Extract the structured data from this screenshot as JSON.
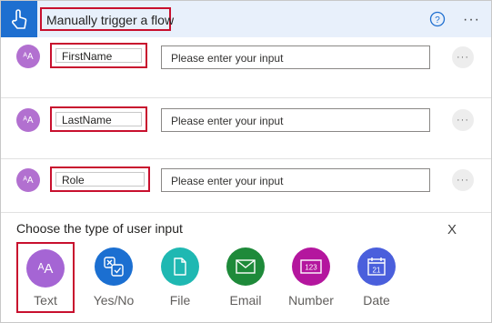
{
  "header": {
    "title": "Manually trigger a flow",
    "help_icon": "help-circle-icon",
    "more_label": "···"
  },
  "inputs": [
    {
      "avatar": "ᴬA",
      "name": "FirstName",
      "placeholder": "Please enter your input",
      "more": "···"
    },
    {
      "avatar": "ᴬA",
      "name": "LastName",
      "placeholder": "Please enter your input",
      "more": "···"
    },
    {
      "avatar": "ᴬA",
      "name": "Role",
      "placeholder": "Please enter your input",
      "more": "···"
    }
  ],
  "chooser": {
    "title": "Choose the type of user input",
    "close_label": "X",
    "options": [
      {
        "label": "Text",
        "icon": "text-icon",
        "color": "#a565d4"
      },
      {
        "label": "Yes/No",
        "icon": "yes-no-icon",
        "color": "#1b6fd1"
      },
      {
        "label": "File",
        "icon": "file-icon",
        "color": "#1fb8b2"
      },
      {
        "label": "Email",
        "icon": "email-icon",
        "color": "#1e8a3a"
      },
      {
        "label": "Number",
        "icon": "number-icon",
        "color": "#b4169e"
      },
      {
        "label": "Date",
        "icon": "calendar-icon",
        "color": "#4a5fdc"
      }
    ]
  },
  "colors": {
    "header_bg": "#e8f0fb",
    "trigger_blue": "#1e6fd0",
    "highlight_red": "#c8102e",
    "avatar_purple": "#b270d0"
  }
}
